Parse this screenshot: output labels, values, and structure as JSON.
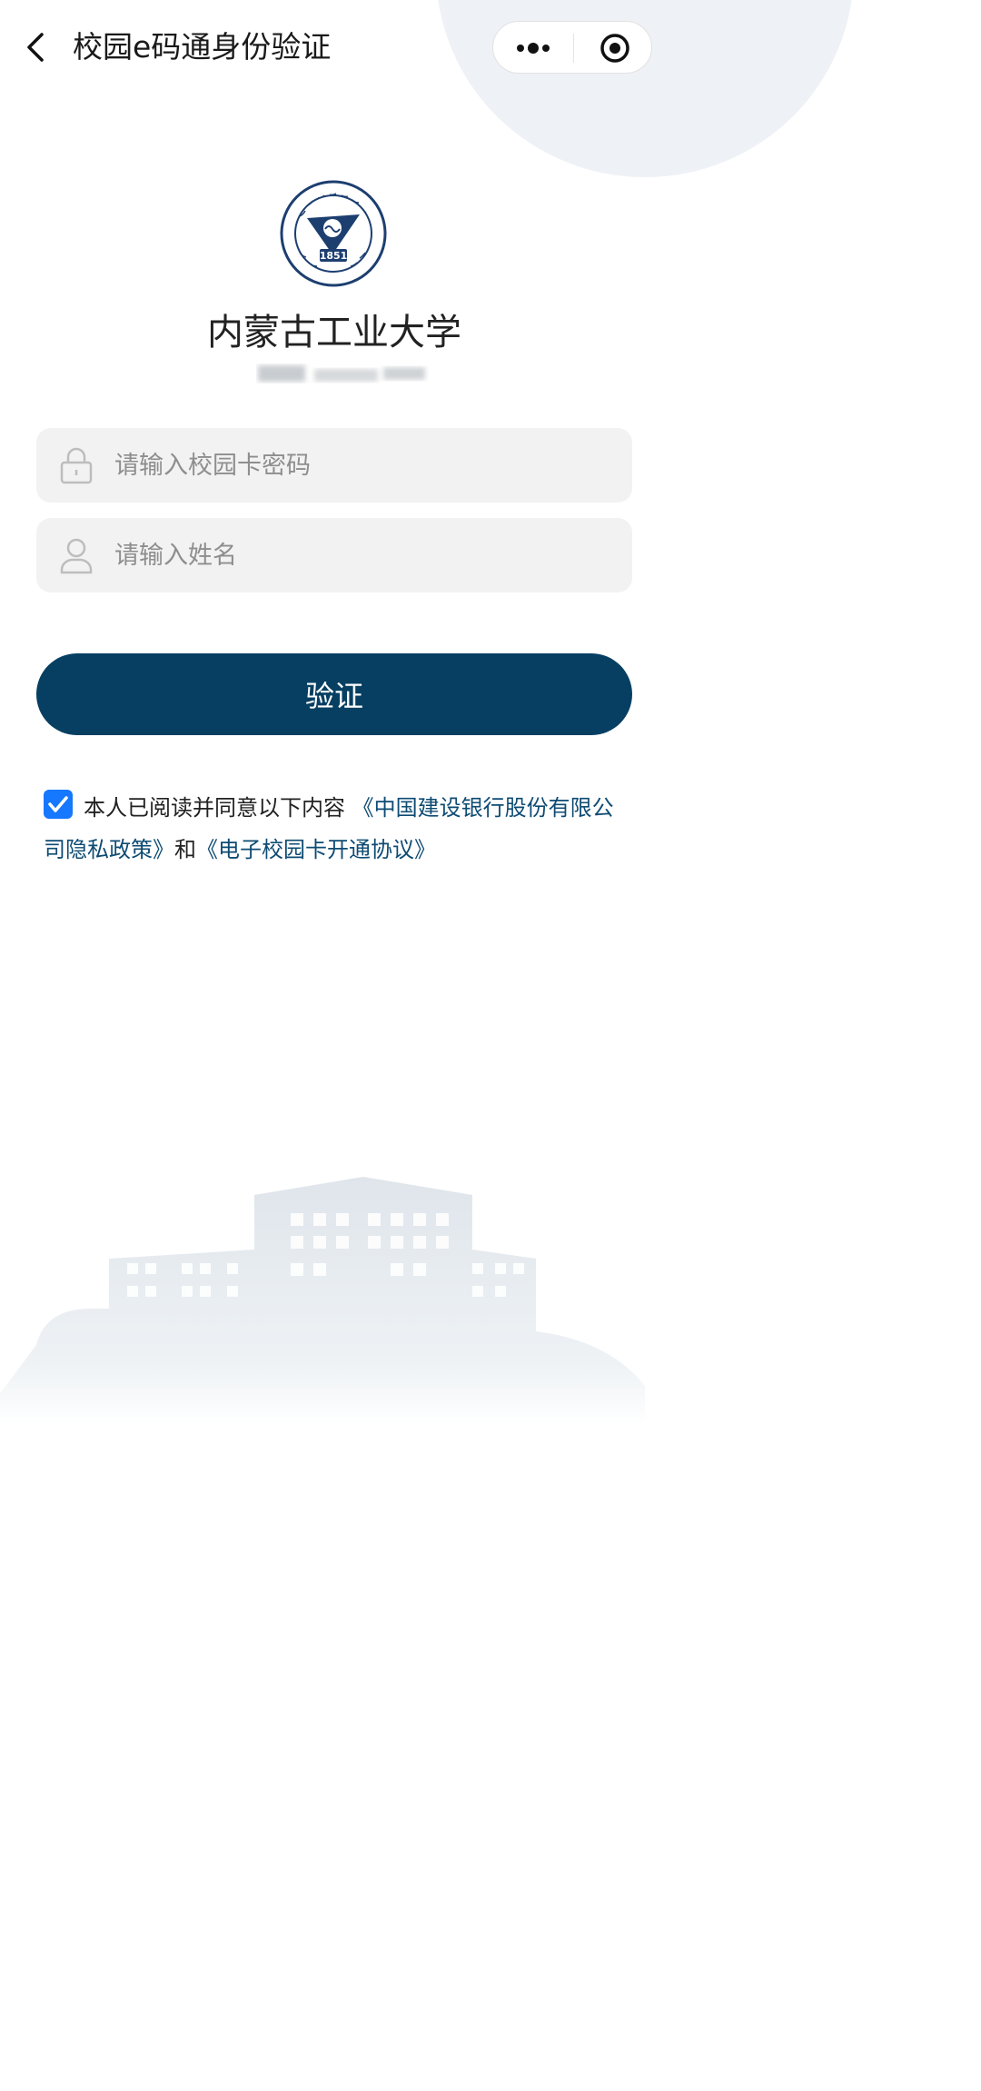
{
  "header": {
    "title": "校园e码通身份验证",
    "icons": {
      "back": "chevron-left-icon",
      "more": "more-dots-icon",
      "close": "target-close-icon"
    }
  },
  "school": {
    "name": "内蒙古工业大学",
    "logo_year": "1851"
  },
  "form": {
    "password_placeholder": "请输入校园卡密码",
    "name_placeholder": "请输入姓名",
    "password_icon": "lock-icon",
    "name_icon": "user-icon"
  },
  "verify_button": "验证",
  "agreement": {
    "checked": true,
    "prefix": "本人已阅读并同意以下内容 ",
    "link1": "《中国建设银行股份有限公司隐私政策》",
    "joiner": "和",
    "link2": "《电子校园卡开通协议》"
  },
  "colors": {
    "primary": "#063f62",
    "checkbox": "#1677ff",
    "link": "#0e4b73",
    "field_bg": "#f2f2f2"
  }
}
